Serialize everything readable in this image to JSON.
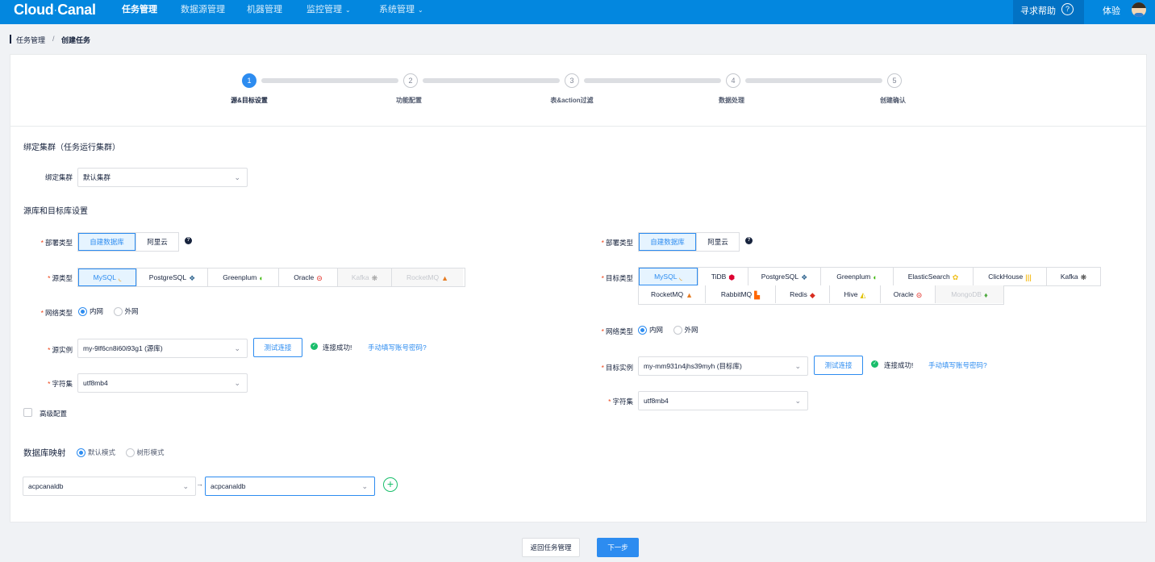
{
  "nav": {
    "logo": "Cloud",
    "logo_sub": "·",
    "logo_tail": "Canal",
    "items": [
      {
        "label": "任务管理"
      },
      {
        "label": "数据源管理"
      },
      {
        "label": "机器管理"
      },
      {
        "label": "监控管理"
      },
      {
        "label": "系统管理"
      }
    ],
    "help": "寻求帮助",
    "help_icon": "?",
    "user": "体验"
  },
  "breadcrumb": {
    "parent": "任务管理",
    "sep": "/",
    "current": "创建任务"
  },
  "steps": [
    {
      "num": "1",
      "label": "源&目标设置",
      "active": true
    },
    {
      "num": "2",
      "label": "功能配置"
    },
    {
      "num": "3",
      "label": "表&action过滤"
    },
    {
      "num": "4",
      "label": "数据处理"
    },
    {
      "num": "5",
      "label": "创建确认"
    }
  ],
  "cluster": {
    "section_title": "绑定集群（任务运行集群）",
    "label": "绑定集群",
    "value": "默认集群"
  },
  "db_section_title": "源库和目标库设置",
  "source": {
    "deploy_label": "部署类型",
    "deploy_options": [
      "自建数据库",
      "阿里云"
    ],
    "deploy_help": "?",
    "type_label": "源类型",
    "types": [
      {
        "label": "MySQL",
        "icon": "mysql-dolphin",
        "glyph": "◟",
        "color": "#e48e00"
      },
      {
        "label": "PostgreSQL",
        "icon": "postgresql-elephant",
        "glyph": "❖",
        "color": "#336791"
      },
      {
        "label": "Greenplum",
        "icon": "greenplum-logo",
        "glyph": "◐",
        "color": "#3db80c"
      },
      {
        "label": "Oracle",
        "icon": "oracle-logo",
        "glyph": "⊝",
        "color": "#e2231a"
      },
      {
        "label": "Kafka",
        "icon": "kafka-logo",
        "glyph": "❋",
        "color": "#333333"
      },
      {
        "label": "RocketMQ",
        "icon": "rocketmq-logo",
        "glyph": "▲",
        "color": "#e57c24"
      }
    ],
    "net_label": "网络类型",
    "net_options": [
      "内网",
      "外网"
    ],
    "instance_label": "源实例",
    "instance_value": "my-9lf6cn8i60i93g1 (源库)",
    "test_btn": "测试连接",
    "ok_icon": "✓",
    "ok_text": "连接成功!",
    "manual_link": "手动填写账号密码?",
    "charset_label": "字符集",
    "charset_value": "utf8mb4",
    "advanced_label": "高级配置"
  },
  "target": {
    "deploy_label": "部署类型",
    "deploy_options": [
      "自建数据库",
      "阿里云"
    ],
    "deploy_help": "?",
    "type_label": "目标类型",
    "types_row1": [
      {
        "label": "MySQL",
        "icon": "mysql-dolphin",
        "glyph": "◟",
        "color": "#e48e00"
      },
      {
        "label": "TiDB",
        "icon": "tidb-logo",
        "glyph": "⬢",
        "color": "#dd0031"
      },
      {
        "label": "PostgreSQL",
        "icon": "postgresql-elephant",
        "glyph": "❖",
        "color": "#336791"
      },
      {
        "label": "Greenplum",
        "icon": "greenplum-logo",
        "glyph": "◐",
        "color": "#3db80c"
      },
      {
        "label": "ElasticSearch",
        "icon": "elasticsearch-logo",
        "glyph": "✿",
        "color": "#f0bf1a"
      },
      {
        "label": "ClickHouse",
        "icon": "clickhouse-bars",
        "glyph": "|||",
        "color": "#f6c12b"
      },
      {
        "label": "Kafka",
        "icon": "kafka-logo",
        "glyph": "❋",
        "color": "#333333"
      }
    ],
    "types_row2": [
      {
        "label": "RocketMQ",
        "icon": "rocketmq-logo",
        "glyph": "▲",
        "color": "#e57c24"
      },
      {
        "label": "RabbitMQ",
        "icon": "rabbitmq-logo",
        "glyph": "▙",
        "color": "#ff6600"
      },
      {
        "label": "Redis",
        "icon": "redis-logo",
        "glyph": "◆",
        "color": "#d82c20"
      },
      {
        "label": "Hive",
        "icon": "hive-logo",
        "glyph": "◭",
        "color": "#e0c200"
      },
      {
        "label": "Oracle",
        "icon": "oracle-logo",
        "glyph": "⊝",
        "color": "#e2231a"
      },
      {
        "label": "MongoDB",
        "icon": "mongodb-leaf",
        "glyph": "♦",
        "color": "#4faa41"
      }
    ],
    "net_label": "网络类型",
    "net_options": [
      "内网",
      "外网"
    ],
    "instance_label": "目标实例",
    "instance_value": "my-mm931n4jhs39myh (目标库)",
    "test_btn": "测试连接",
    "ok_icon": "✓",
    "ok_text": "连接成功!",
    "manual_link": "手动填写账号密码?",
    "charset_label": "字符集",
    "charset_value": "utf8mb4"
  },
  "mapping": {
    "title": "数据库映射",
    "modes": [
      "默认模式",
      "树形模式"
    ],
    "source_db": "acpcanaldb",
    "target_db": "acpcanaldb",
    "arrow": "→",
    "add": "+"
  },
  "footer": {
    "back": "返回任务管理",
    "next": "下一步"
  },
  "colors": {
    "primary": "#2d8cf0",
    "nav": "#0387df",
    "success": "#19be6b",
    "required": "#ed4014"
  }
}
